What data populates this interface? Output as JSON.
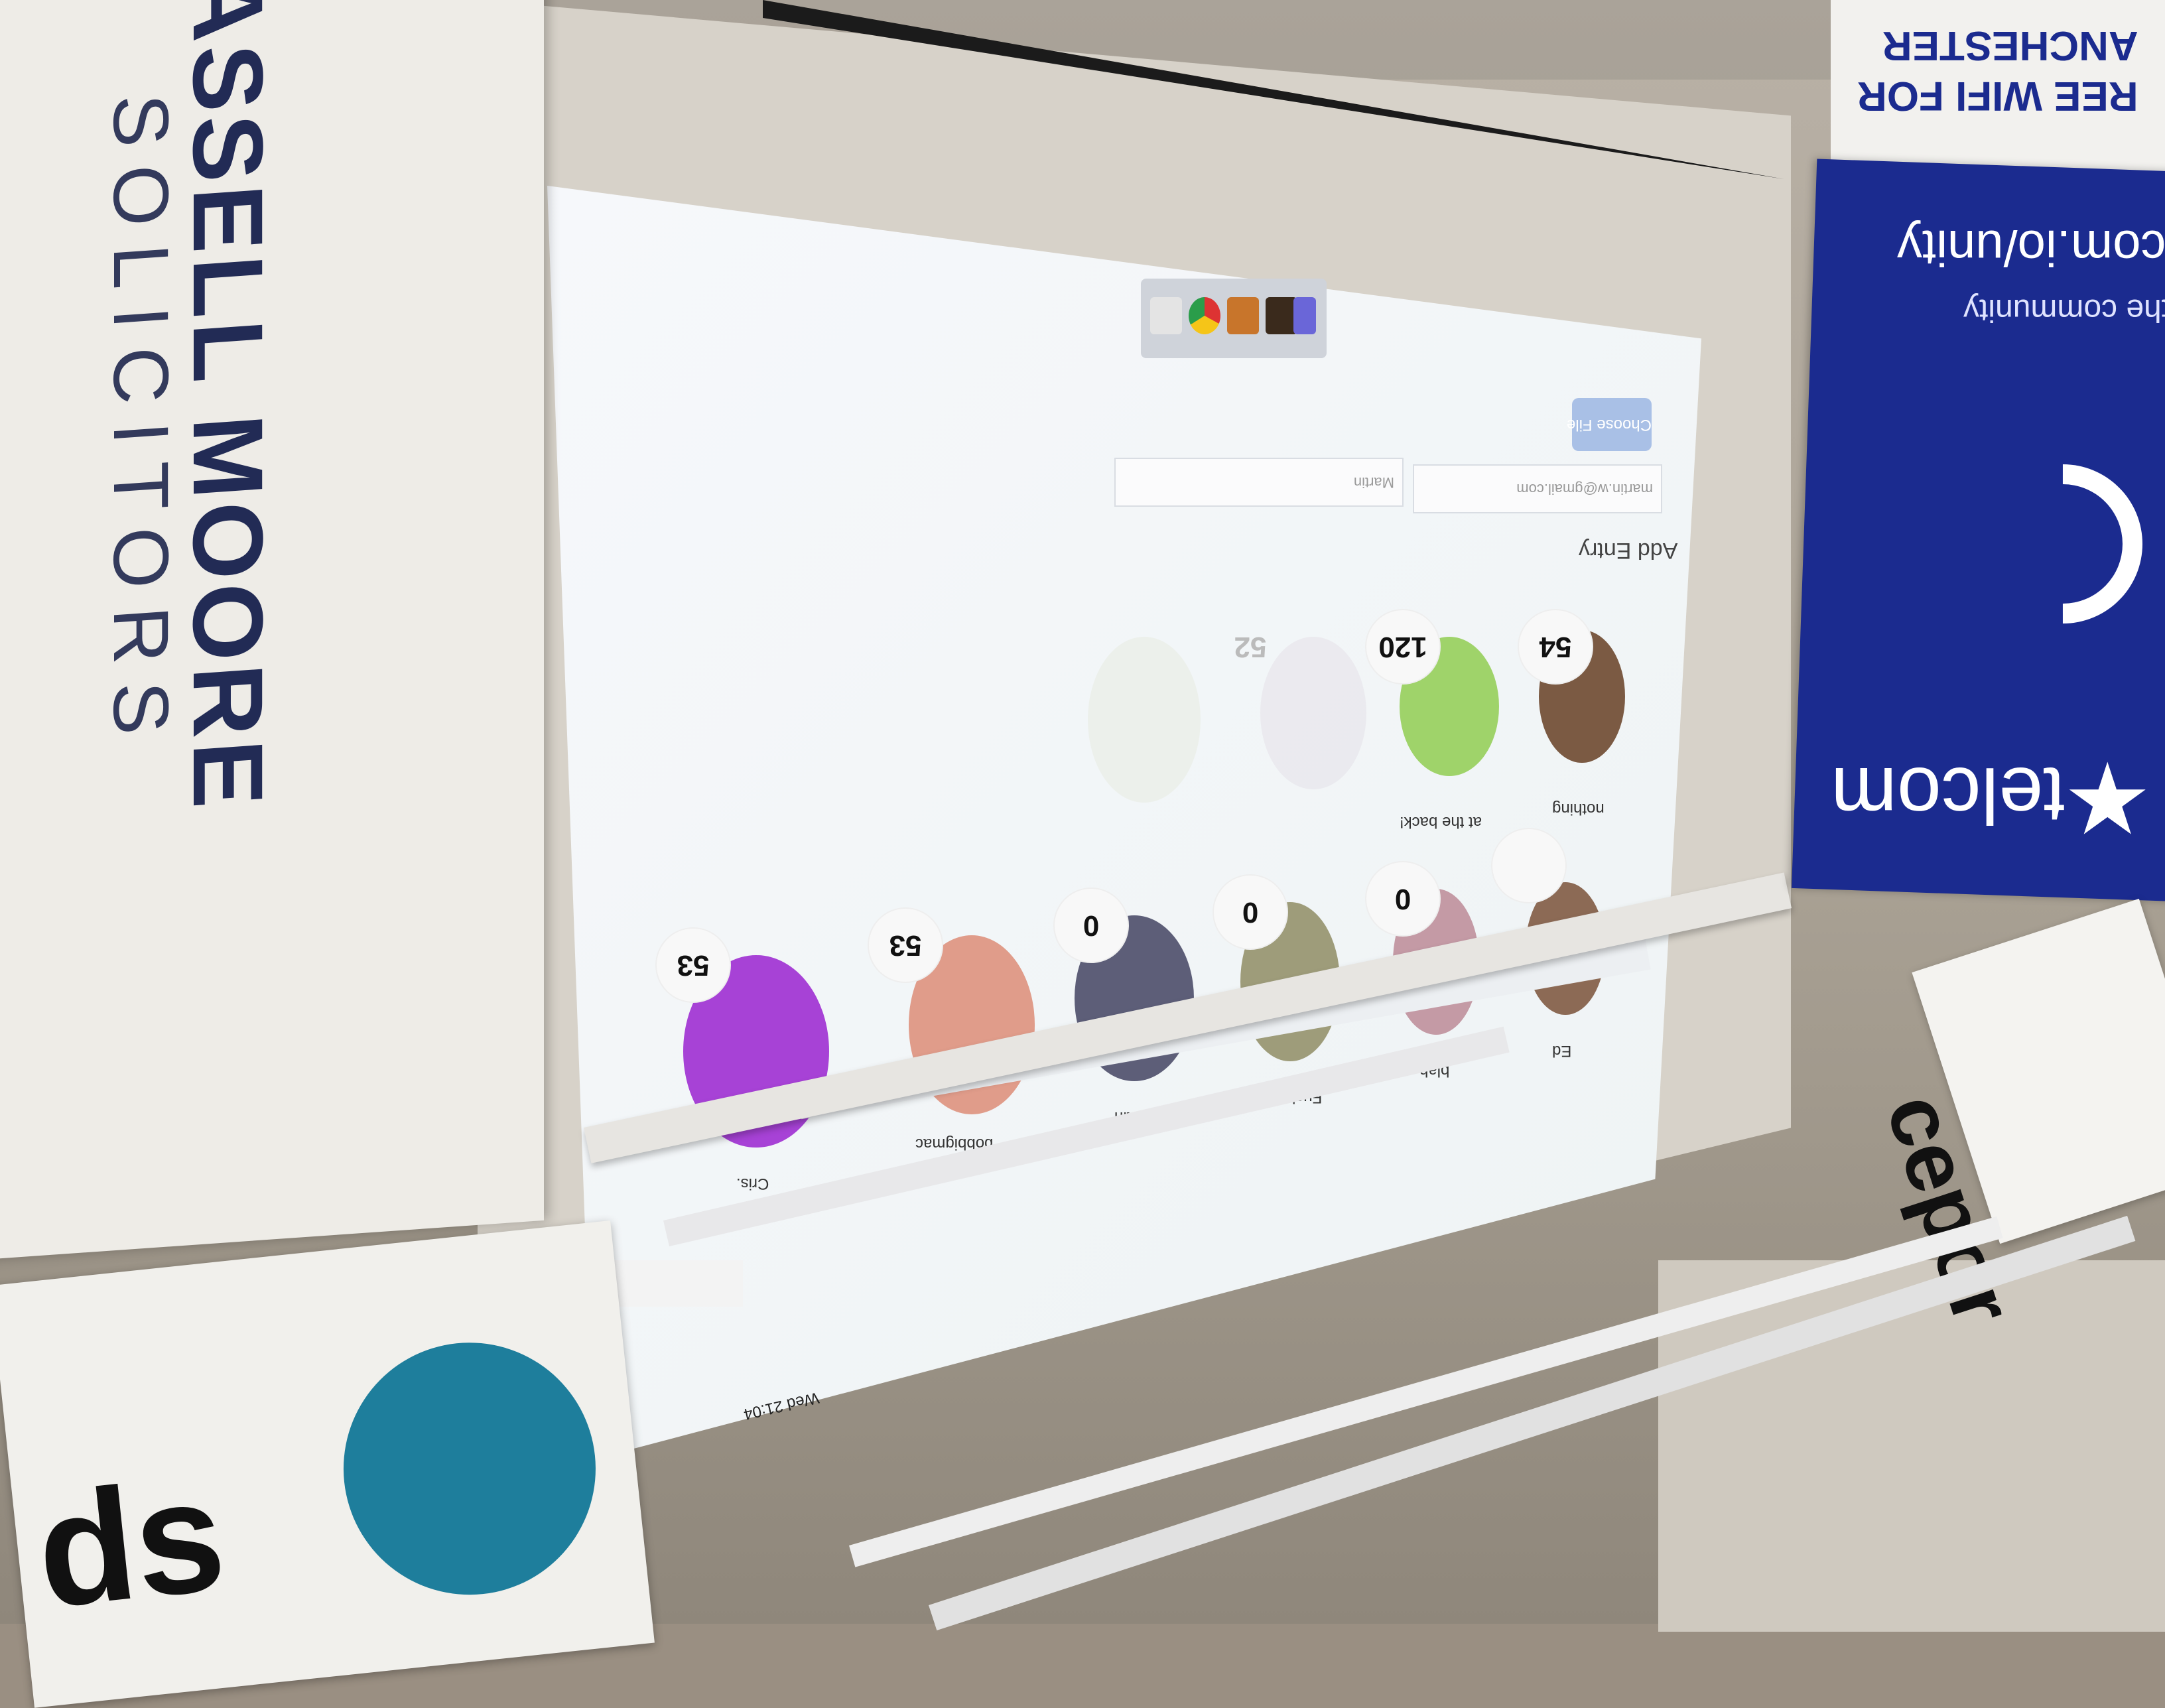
{
  "left_banner": {
    "brand": "ASSELL MOORE",
    "subtitle": "SOLICITORS"
  },
  "left_sign": {
    "text": "ds"
  },
  "right_banner": {
    "top_text_line1": "REE WIFI FOR",
    "top_text_line2": "ANCHESTER",
    "url": "com.io/unity",
    "tagline": "the community",
    "brand": "telcom"
  },
  "right_sign": {
    "text": "cepor"
  },
  "projection": {
    "choose_file_label": "Choose File",
    "email_placeholder": "martin.w@gmail.com",
    "name_placeholder": "Martin",
    "add_entry_label": "Add Entry",
    "top_row": [
      {
        "label": "nothing",
        "score": "54"
      },
      {
        "label": "at the back!",
        "score": "120"
      },
      {
        "label": "",
        "score": "52"
      },
      {
        "label": "",
        "score": ""
      }
    ],
    "bottom_row": [
      {
        "label": "Ed",
        "score": ""
      },
      {
        "label": "blah",
        "score": "0"
      },
      {
        "label": "FuckIT",
        "score": "0"
      },
      {
        "label": "Martin",
        "score": "0"
      },
      {
        "label": "bobbigmac",
        "score": "53"
      },
      {
        "label": "Cris.",
        "score": "53"
      }
    ],
    "clock": "Wed 21:04"
  },
  "colors": {
    "brand_blue": "#1b2b8f",
    "accent_teal": "#1e7e9c",
    "button_blue": "#a9c0e6"
  }
}
